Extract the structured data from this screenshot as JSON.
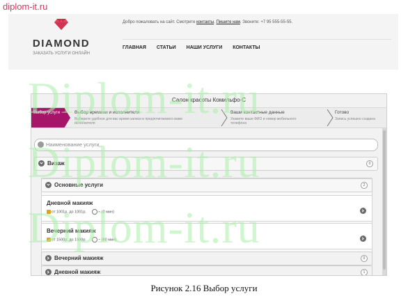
{
  "doc": {
    "site": "diplom-it.ru",
    "caption": "Рисунок 2.16 Выбор услуги",
    "watermark": "Diplom-it.ru"
  },
  "site": {
    "brand": "DIAMOND",
    "brand_sub": "ЗАКАЗАТЬ УСЛУГИ ОНЛАЙН",
    "welcome_prefix": "Добро пожаловать на сайт. Смотрите",
    "welcome_contacts": "контакты",
    "welcome_write": "Пишите нам",
    "welcome_call": "Звоните: +7 95 555-55-55.",
    "nav": [
      "ГЛАВНАЯ",
      "СТАТЬИ",
      "НАШИ УСЛУГИ",
      "КОНТАКТЫ"
    ]
  },
  "widget": {
    "title": "Салон красоты Комильфо-С",
    "steps": [
      {
        "title": "Выбор услуги"
      },
      {
        "title": "Выбор времени и исполнителя",
        "desc": "Выберите удобное для вас время записи и предпочитаемого вами исполнителя"
      },
      {
        "title": "Ваши контактные данные",
        "desc": "Укажите ваше ФИО и номер мобильного телефона"
      },
      {
        "title": "Готово",
        "desc": "Запись успешно создана"
      }
    ],
    "search_placeholder": "Наименование услуги...",
    "categories": [
      {
        "label": "Визаж",
        "count": "0"
      },
      {
        "label": "Основные услуги",
        "count": "2"
      },
      {
        "label": "Вечерний макияж",
        "count": "0"
      },
      {
        "label": "Дневной макияж",
        "count": "1"
      }
    ],
    "services": [
      {
        "name": "Дневной макияж",
        "price": "от 1001р. до 1001р.",
        "duration": "~ (0 мин)"
      },
      {
        "name": "Вечерний макияж",
        "price": "от 1500р. до 1500р.",
        "duration": "~ (60 мин)"
      }
    ]
  }
}
